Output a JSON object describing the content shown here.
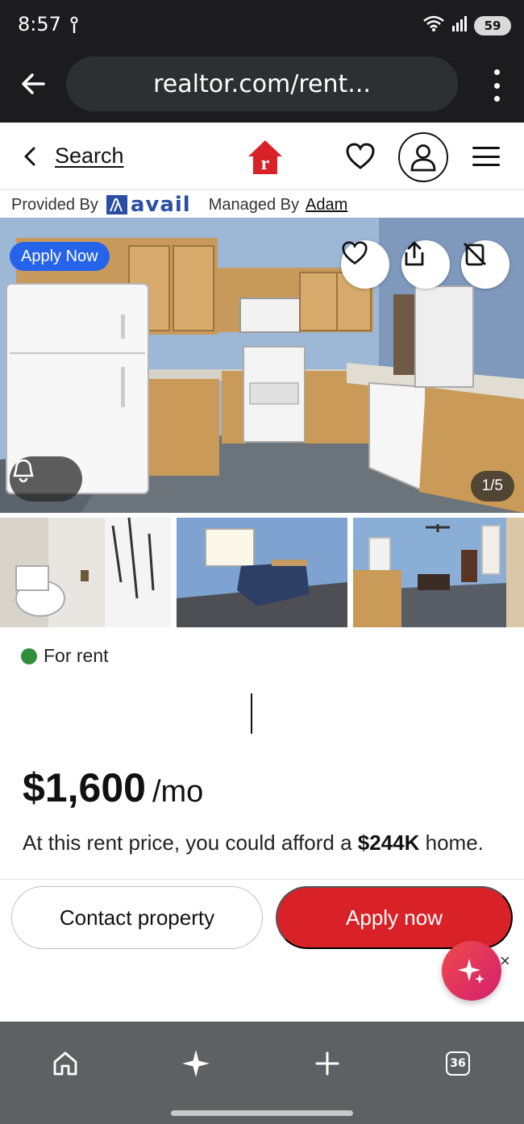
{
  "status_bar": {
    "time": "8:57",
    "battery": "59"
  },
  "browser": {
    "url": "realtor.com/rent..."
  },
  "header": {
    "back_label": "Search"
  },
  "listing": {
    "provided_by_label": "Provided By",
    "provider_name": "avail",
    "managed_by_label": "Managed By",
    "manager_name": "Adam",
    "apply_badge": "Apply Now",
    "photo_counter": "1/5",
    "status": "For rent",
    "status_color": "#2f8f3a",
    "price": "$1,600",
    "price_unit": "/mo",
    "afford_prefix": "At this rent price, you could afford a",
    "afford_amount": "$244K",
    "afford_suffix": "home."
  },
  "actions": {
    "contact": "Contact property",
    "apply": "Apply now",
    "close": "×"
  },
  "bottom_nav": {
    "tab_count": "36"
  },
  "colors": {
    "brand_red": "#d92228",
    "apply_blue": "#2563eb"
  },
  "icons": [
    "back-arrow-icon",
    "more-vert-icon",
    "chevron-left-icon",
    "realtor-logo-icon",
    "heart-icon",
    "user-icon",
    "hamburger-menu-icon",
    "share-icon",
    "hide-icon",
    "tour-icon",
    "sparkle-icon",
    "home-icon",
    "plus-icon",
    "tabs-icon"
  ]
}
